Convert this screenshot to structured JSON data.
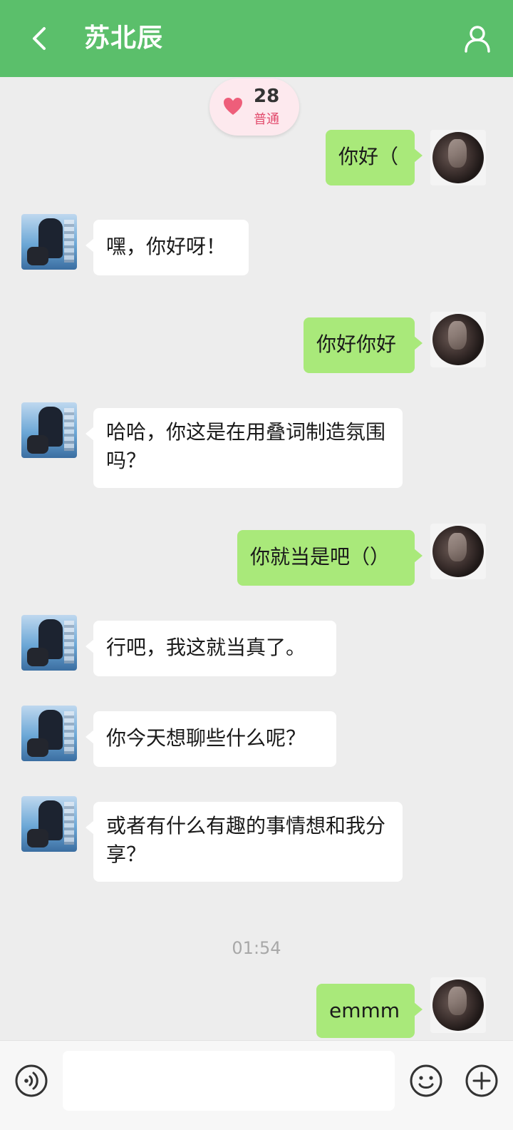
{
  "header": {
    "title": "苏北辰",
    "back_icon": "chevron-left-icon",
    "profile_icon": "user-icon",
    "background": "#5bbf6b"
  },
  "badge": {
    "value": "28",
    "level": "普通",
    "icon": "heart-icon"
  },
  "messages": [
    {
      "sender": "me",
      "text": "你好（"
    },
    {
      "sender": "other",
      "text": "嘿，你好呀！"
    },
    {
      "sender": "me",
      "text": "你好你好"
    },
    {
      "sender": "other",
      "text": "哈哈，你这是在用叠词制造氛围吗？"
    },
    {
      "sender": "me",
      "text": "你就当是吧（）"
    },
    {
      "sender": "other",
      "text": "行吧，我这就当真了。"
    },
    {
      "sender": "other",
      "text": "你今天想聊些什么呢？"
    },
    {
      "sender": "other",
      "text": "或者有什么有趣的事情想和我分享？"
    },
    {
      "sender": "me",
      "text": "emmm"
    }
  ],
  "timestamp": "01:54",
  "input_bar": {
    "placeholder": "",
    "voice_icon": "voice-icon",
    "emoji_icon": "emoji-icon",
    "plus_icon": "plus-icon"
  },
  "colors": {
    "my_bubble": "#a9e97a",
    "their_bubble": "#ffffff",
    "background": "#ededed"
  }
}
